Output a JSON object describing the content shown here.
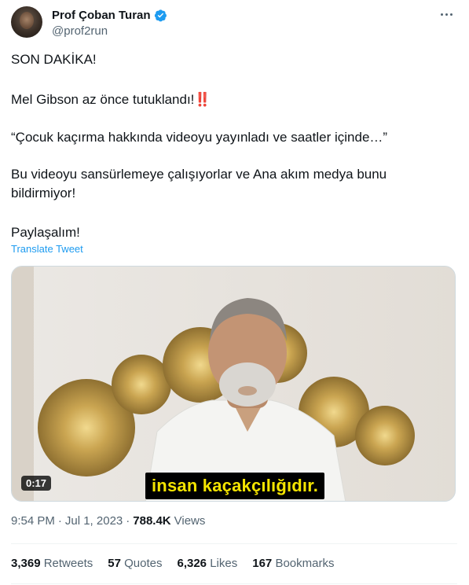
{
  "author": {
    "display_name": "Prof Çoban Turan",
    "handle": "@prof2run",
    "verified_color": "#1d9bf0"
  },
  "tweet": {
    "line1": "SON DAKİKA!",
    "line2": "Mel Gibson az önce tutuklandı!",
    "line2_emoji": "‼️",
    "line3": "“Çocuk kaçırma hakkında videoyu yayınladı ve saatler içinde…”",
    "line4": "Bu videoyu sansürlemeye çalışıyorlar ve Ana akım medya bunu bildirmiyor!",
    "line5": "Paylaşalım!",
    "translate_label": "Translate Tweet"
  },
  "media": {
    "duration": "0:17",
    "subtitle": "insan kaçakçılığıdır."
  },
  "meta": {
    "time": "9:54 PM",
    "separator1": "·",
    "date": "Jul 1, 2023",
    "separator2": "·",
    "views_count": "788.4K",
    "views_label": "Views"
  },
  "stats": {
    "retweets_count": "3,369",
    "retweets_label": "Retweets",
    "quotes_count": "57",
    "quotes_label": "Quotes",
    "likes_count": "6,326",
    "likes_label": "Likes",
    "bookmarks_count": "167",
    "bookmarks_label": "Bookmarks"
  },
  "icons": {
    "verified": "verified-badge-icon",
    "more": "more-options-icon",
    "play": "video-player"
  },
  "colors": {
    "link": "#1d9bf0",
    "secondary_text": "#536471",
    "primary_text": "#0f1419",
    "subtitle_text": "#f4e400"
  }
}
